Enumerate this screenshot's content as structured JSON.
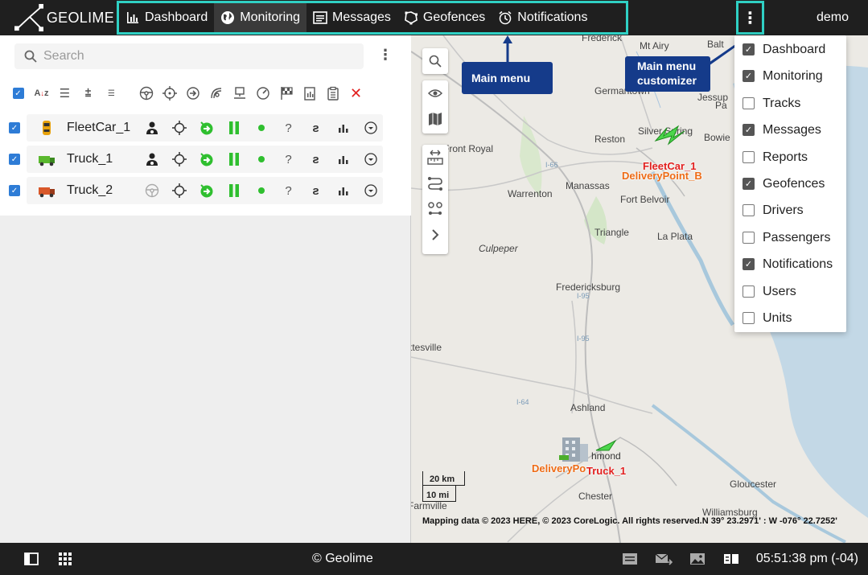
{
  "app": {
    "name": "GEOLIME",
    "user": "demo"
  },
  "main_menu": {
    "items": [
      {
        "label": "Dashboard",
        "icon": "bar-chart-icon"
      },
      {
        "label": "Monitoring",
        "icon": "globe-icon",
        "active": true
      },
      {
        "label": "Messages",
        "icon": "message-icon"
      },
      {
        "label": "Geofences",
        "icon": "geofence-icon"
      },
      {
        "label": "Notifications",
        "icon": "alarm-clock-icon"
      }
    ]
  },
  "search": {
    "placeholder": "Search"
  },
  "units": [
    {
      "name": "FleetCar_1",
      "icon": "car-icon",
      "checked": true
    },
    {
      "name": "Truck_1",
      "icon": "truck-green-icon",
      "checked": true
    },
    {
      "name": "Truck_2",
      "icon": "truck-red-icon",
      "checked": true
    }
  ],
  "map": {
    "callouts": {
      "main_menu": "Main menu",
      "customizer_line1": "Main menu",
      "customizer_line2": "customizer"
    },
    "places": [
      "Frederick",
      "Mt Airy",
      "Germantown",
      "Silver Spring",
      "Reston",
      "Bowie",
      "Front Royal",
      "Warrenton",
      "Manassas",
      "Fort Belvoir",
      "Triangle",
      "La Plata",
      "Culpeper",
      "Fredericksburg",
      "Ashland",
      "Gloucester",
      "Chester",
      "Williamsburg",
      "ttesville",
      "Farmville",
      "I-66",
      "I-95",
      "I-64",
      "Jessup",
      "Balt",
      "Pa"
    ],
    "markers": {
      "fleetcar": "FleetCar_1",
      "delivery_b": "DeliveryPoint_B",
      "delivery_a": "DeliveryPo",
      "truck": "Truck_1",
      "richmond": "hmond"
    },
    "scale": {
      "km": "20 km",
      "mi": "10 mi"
    },
    "copyright": "Mapping data © 2023 HERE, © 2023 CoreLogic. All rights reserved.N 39° 23.2971' : W -076° 22.7252'"
  },
  "customizer": {
    "items": [
      {
        "label": "Dashboard",
        "checked": true
      },
      {
        "label": "Monitoring",
        "checked": true
      },
      {
        "label": "Tracks",
        "checked": false
      },
      {
        "label": "Messages",
        "checked": true
      },
      {
        "label": "Reports",
        "checked": false
      },
      {
        "label": "Geofences",
        "checked": true
      },
      {
        "label": "Drivers",
        "checked": false
      },
      {
        "label": "Passengers",
        "checked": false
      },
      {
        "label": "Notifications",
        "checked": true
      },
      {
        "label": "Users",
        "checked": false
      },
      {
        "label": "Units",
        "checked": false
      }
    ]
  },
  "footer": {
    "copyright": "© Geolime",
    "time": "05:51:38 pm (-04)"
  },
  "colors": {
    "accent": "#2fd0c4",
    "callout": "#153b8a",
    "green": "#2fbf2f",
    "red": "#e2201f"
  }
}
